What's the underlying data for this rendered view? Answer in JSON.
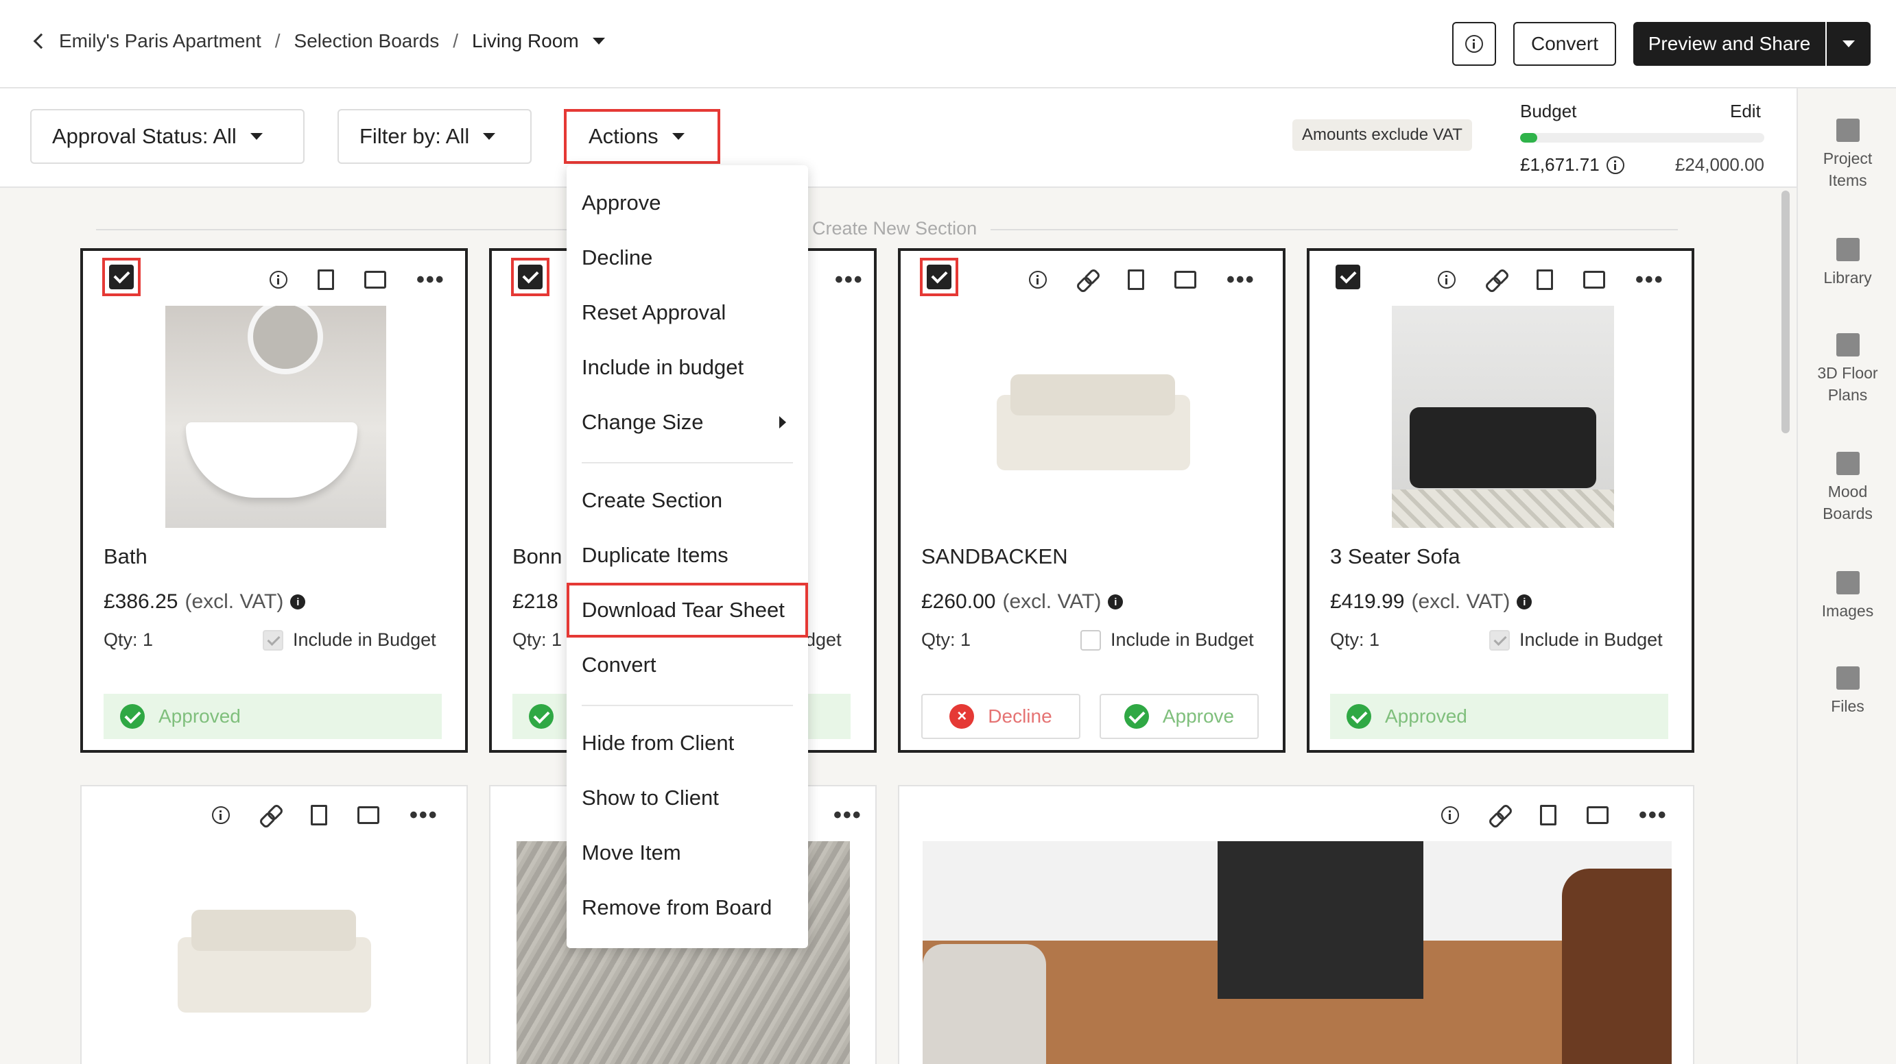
{
  "breadcrumb": {
    "project": "Emily's Paris Apartment",
    "section": "Selection Boards",
    "current": "Living Room",
    "separator": "/"
  },
  "header": {
    "convert_label": "Convert",
    "preview_label": "Preview and Share"
  },
  "filters": {
    "approval_status": "Approval Status: All",
    "filter_by": "Filter by: All",
    "actions": "Actions"
  },
  "vat_badge": "Amounts exclude VAT",
  "budget": {
    "label": "Budget",
    "edit": "Edit",
    "spent": "£1,671.71",
    "total": "£24,000.00",
    "progress_fraction": 0.07
  },
  "section_label": "Create New Section",
  "sidebar": {
    "items": [
      {
        "label_line1": "Project",
        "label_line2": "Items",
        "icon": "project-items-icon"
      },
      {
        "label_line1": "Library",
        "label_line2": "",
        "icon": "library-icon"
      },
      {
        "label_line1": "3D Floor",
        "label_line2": "Plans",
        "icon": "floor-plans-icon"
      },
      {
        "label_line1": "Mood",
        "label_line2": "Boards",
        "icon": "mood-boards-icon"
      },
      {
        "label_line1": "Images",
        "label_line2": "",
        "icon": "images-icon"
      },
      {
        "label_line1": "Files",
        "label_line2": "",
        "icon": "files-icon"
      }
    ]
  },
  "cards": [
    {
      "title": "Bath",
      "price": "£386.25",
      "price_suffix": "(excl. VAT)",
      "qty": "Qty: 1",
      "include_label": "Include in Budget",
      "status": "Approved",
      "included": true
    },
    {
      "title": "Bonn",
      "price": "£218",
      "price_suffix": "",
      "qty": "Qty: 1",
      "include_label": "udget",
      "status": "",
      "included": true
    },
    {
      "title": "SANDBACKEN",
      "price": "£260.00",
      "price_suffix": "(excl. VAT)",
      "qty": "Qty: 1",
      "include_label": "Include in Budget",
      "decline_label": "Decline",
      "approve_label": "Approve",
      "included": false
    },
    {
      "title": "3 Seater Sofa",
      "price": "£419.99",
      "price_suffix": "(excl. VAT)",
      "qty": "Qty: 1",
      "include_label": "Include in Budget",
      "status": "Approved",
      "included": true
    }
  ],
  "actions_menu": {
    "items": [
      "Approve",
      "Decline",
      "Reset Approval",
      "Include in budget",
      "Change Size",
      "Create Section",
      "Duplicate Items",
      "Download Tear Sheet",
      "Convert",
      "Hide from Client",
      "Show to Client",
      "Move Item",
      "Remove from Board"
    ],
    "highlighted": "Download Tear Sheet"
  },
  "colors": {
    "accent_red": "#e53935",
    "approve_green": "#2fa844",
    "dark": "#1d1d1d"
  }
}
